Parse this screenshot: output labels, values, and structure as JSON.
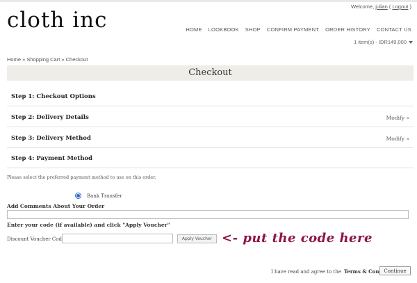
{
  "header": {
    "welcome_prefix": "Welcome, ",
    "user": "julian",
    "logout_open": " ( ",
    "logout": "Logout",
    "logout_close": " )",
    "logo": "cloth inc",
    "nav": [
      "HOME",
      "LOOKBOOK",
      "SHOP",
      "CONFIRM PAYMENT",
      "ORDER HISTORY",
      "CONTACT US"
    ],
    "cart_summary": "1 item(s) - IDR149,000"
  },
  "breadcrumb": "Home » Shopping Cart » Checkout",
  "page_title": "Checkout",
  "steps": [
    {
      "label": "Step 1: Checkout Options",
      "modify": ""
    },
    {
      "label": "Step 2: Delivery Details",
      "modify": "Modify »"
    },
    {
      "label": "Step 3: Delivery Method",
      "modify": "Modify »"
    },
    {
      "label": "Step 4: Payment Method",
      "modify": ""
    }
  ],
  "payment": {
    "instruction": "Please select the preferred payment method to use on this order.",
    "option": "Bank Transfer",
    "selected": true
  },
  "comments": {
    "label": "Add Comments About Your Order",
    "value": ""
  },
  "voucher": {
    "prompt": "Enter your code (if available) and click \"Apply Voucher\"",
    "field_label": "Discount Voucher Code:",
    "value": "",
    "button": "Apply Voucher"
  },
  "annotation": "<- put the code here",
  "agreement": {
    "text": "I have read and agree to the ",
    "terms": "Terms & Conditions",
    "checked": false
  },
  "continue_label": "Continue",
  "colors": {
    "accent_annotation": "#8e1348",
    "title_bar_bg": "#eeede8",
    "radio_accent": "#2a66c9"
  }
}
